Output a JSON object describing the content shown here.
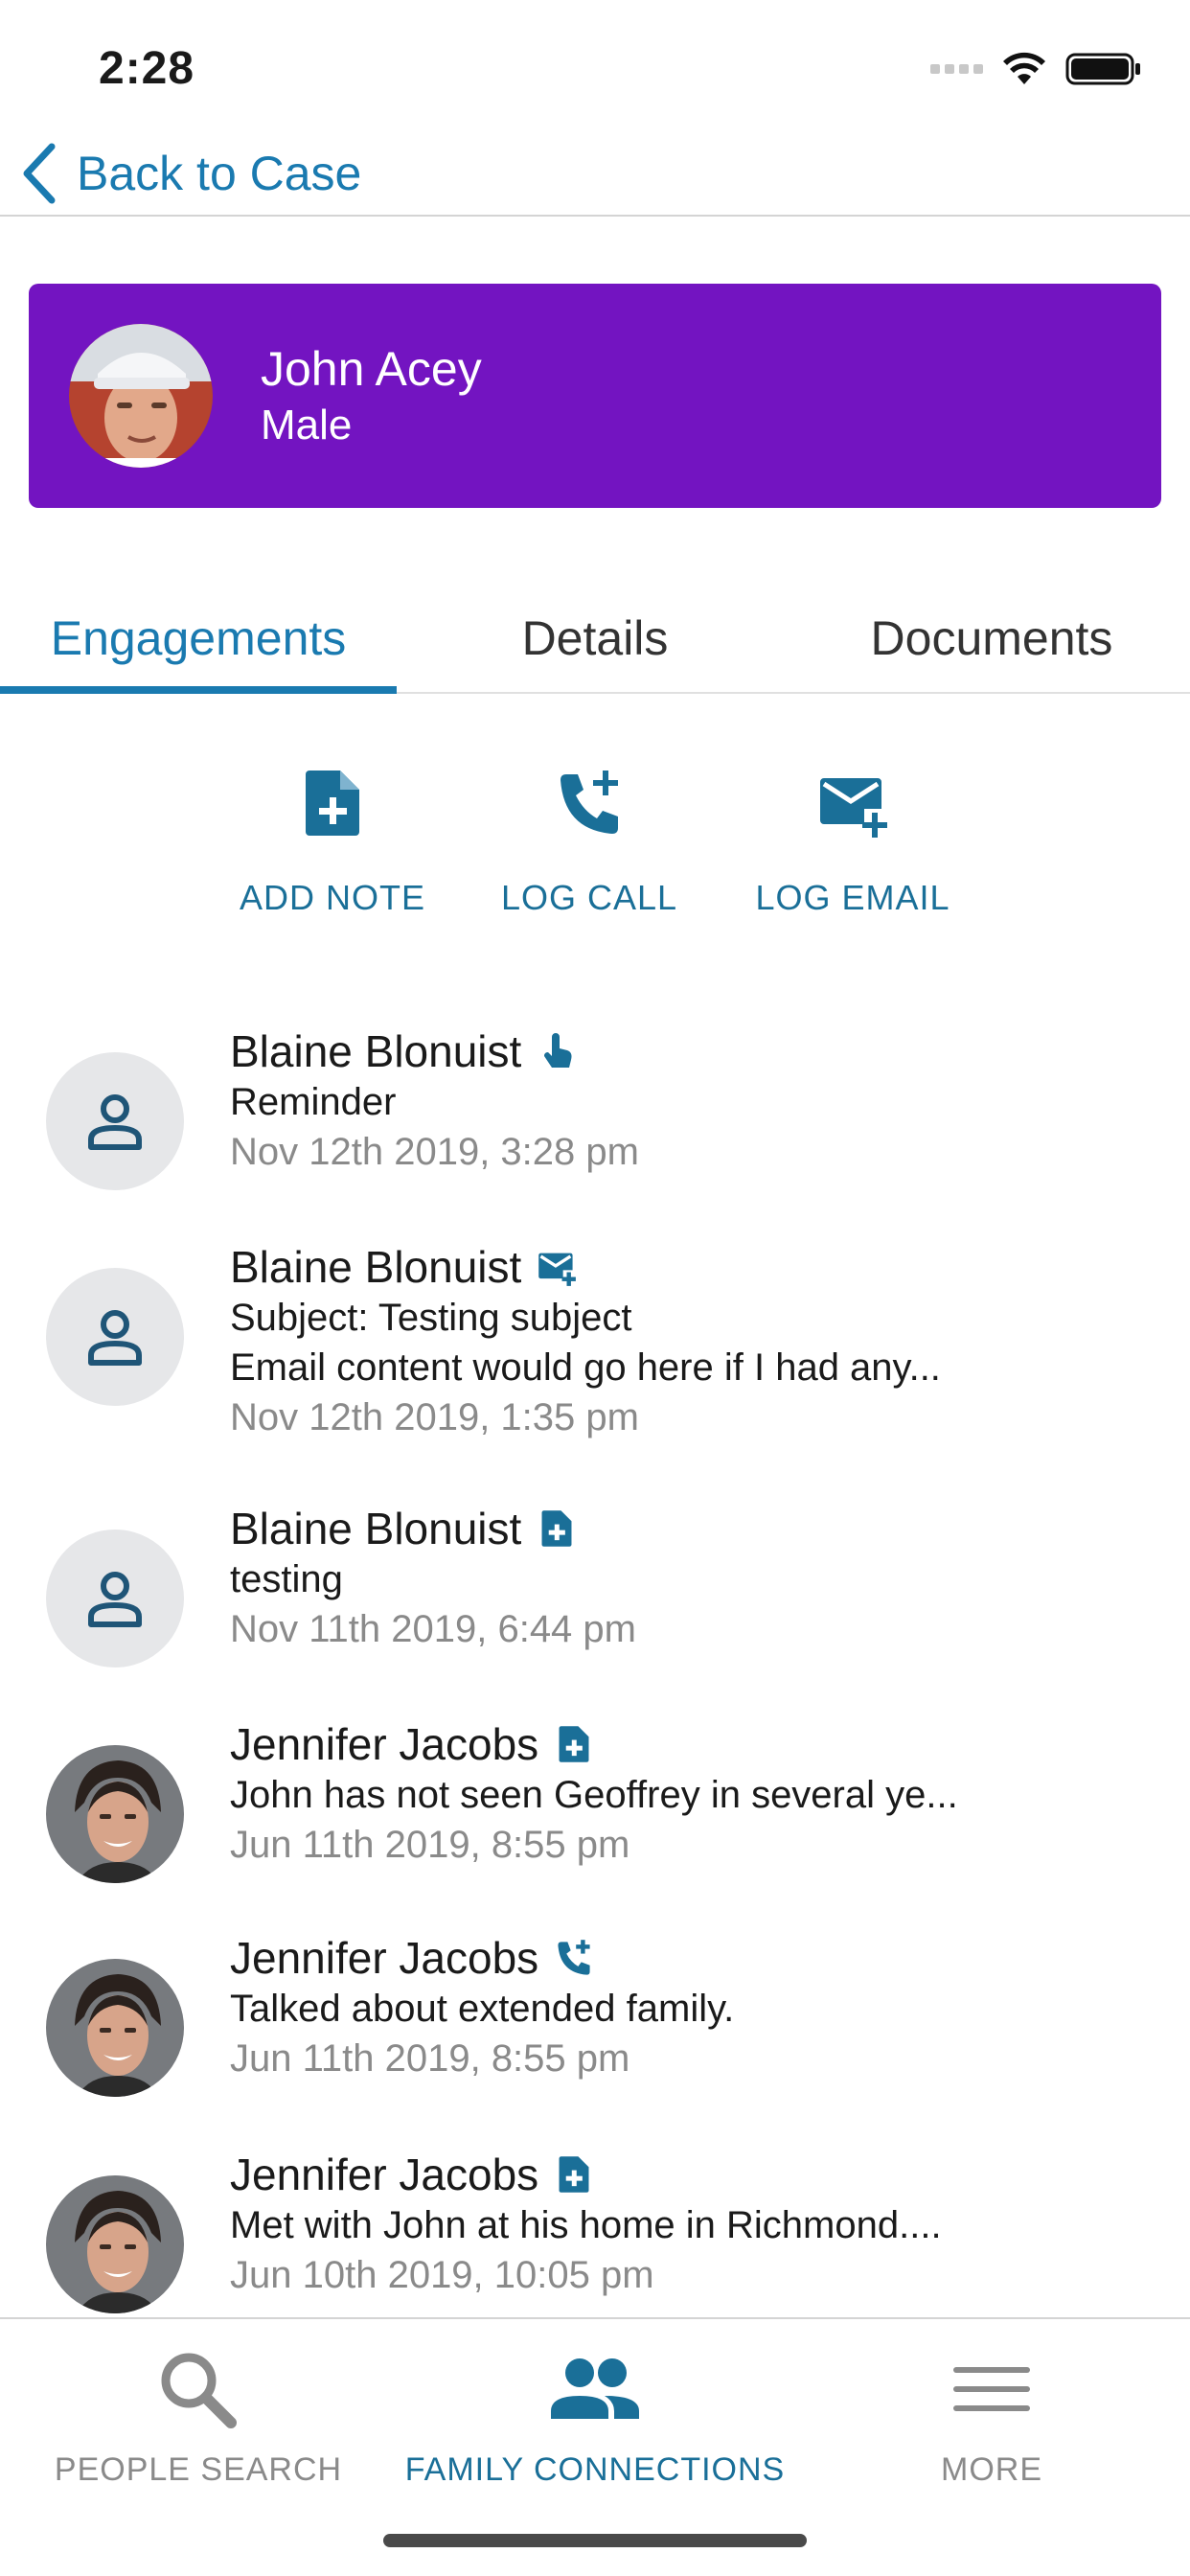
{
  "status_bar": {
    "time": "2:28"
  },
  "nav": {
    "back_label": "Back to Case"
  },
  "profile": {
    "name": "John Acey",
    "gender": "Male",
    "card_color": "#7314c1"
  },
  "tabs": [
    {
      "label": "Engagements",
      "active": true
    },
    {
      "label": "Details",
      "active": false
    },
    {
      "label": "Documents",
      "active": false
    }
  ],
  "actions": [
    {
      "label": "ADD NOTE",
      "icon": "note-add-icon"
    },
    {
      "label": "LOG CALL",
      "icon": "phone-add-icon"
    },
    {
      "label": "LOG EMAIL",
      "icon": "email-add-icon"
    }
  ],
  "engagements": [
    {
      "name": "Blaine Blonuist",
      "type_icon": "hand-pointer-icon",
      "lines": [
        "Reminder"
      ],
      "date": "Nov 12th 2019, 3:28 pm",
      "avatar": "person-placeholder"
    },
    {
      "name": "Blaine Blonuist",
      "type_icon": "email-add-icon",
      "lines": [
        "Subject: Testing subject",
        "Email content would go here if I had any..."
      ],
      "date": "Nov 12th 2019, 1:35 pm",
      "avatar": "person-placeholder"
    },
    {
      "name": "Blaine Blonuist",
      "type_icon": "note-add-icon",
      "lines": [
        "testing"
      ],
      "date": "Nov 11th 2019, 6:44 pm",
      "avatar": "person-placeholder"
    },
    {
      "name": "Jennifer Jacobs",
      "type_icon": "note-add-icon",
      "lines": [
        "John has not seen Geoffrey in several ye..."
      ],
      "date": "Jun 11th 2019, 8:55 pm",
      "avatar": "photo"
    },
    {
      "name": "Jennifer Jacobs",
      "type_icon": "phone-add-icon",
      "lines": [
        "Talked about extended family."
      ],
      "date": "Jun 11th 2019, 8:55 pm",
      "avatar": "photo"
    },
    {
      "name": "Jennifer Jacobs",
      "type_icon": "note-add-icon",
      "lines": [
        "Met with John at his home in Richmond...."
      ],
      "date": "Jun 10th 2019, 10:05 pm",
      "avatar": "photo"
    }
  ],
  "tab_bar": [
    {
      "label": "PEOPLE SEARCH",
      "icon": "search-icon",
      "active": false
    },
    {
      "label": "FAMILY CONNECTIONS",
      "icon": "people-icon",
      "active": true
    },
    {
      "label": "MORE",
      "icon": "menu-icon",
      "active": false
    }
  ],
  "colors": {
    "accent": "#1a7ab0",
    "icon_blue": "#1a6f98",
    "secondary_text": "#8a8a8a"
  }
}
